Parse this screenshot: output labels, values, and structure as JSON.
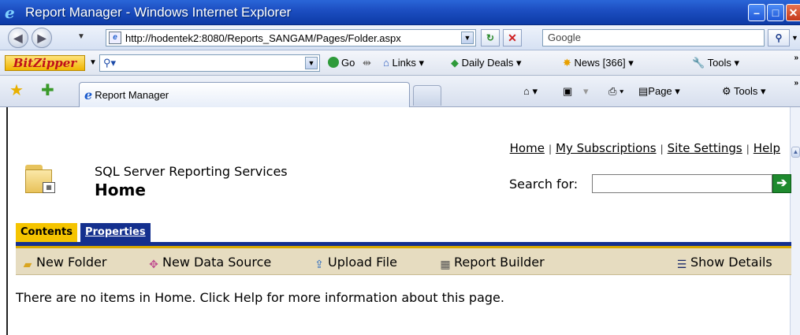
{
  "window": {
    "title": "Report Manager - Windows Internet Explorer",
    "controls": [
      "minimize",
      "maximize",
      "close"
    ]
  },
  "address_bar": {
    "url": "http://hodentek2:8080/Reports_SANGAM/Pages/Folder.aspx",
    "search_placeholder": "Google"
  },
  "toolbar": {
    "brand": "BitZipper",
    "go_label": "Go",
    "links_label": "Links",
    "daily_deals_label": "Daily Deals",
    "news_label": "News [366]",
    "tools_label": "Tools"
  },
  "tabs": {
    "active_tab_label": "Report Manager",
    "page_label": "Page",
    "tools_label": "Tools"
  },
  "page": {
    "top_links": [
      "Home",
      "My Subscriptions",
      "Site Settings",
      "Help"
    ],
    "app_name": "SQL Server Reporting Services",
    "title": "Home",
    "search_label": "Search for:",
    "search_value": "",
    "tab_contents": "Contents",
    "tab_properties": "Properties",
    "actions": {
      "new_folder": "New Folder",
      "new_data_source": "New Data Source",
      "upload_file": "Upload File",
      "report_builder": "Report Builder",
      "show_details": "Show Details"
    },
    "empty_message": "There are no items in Home. Click Help for more information about this page."
  },
  "colors": {
    "tab_active": "#f5c400",
    "tab_inactive": "#14308e",
    "action_bar": "#e6dcc0",
    "title_bar": "#1d4fc2"
  }
}
